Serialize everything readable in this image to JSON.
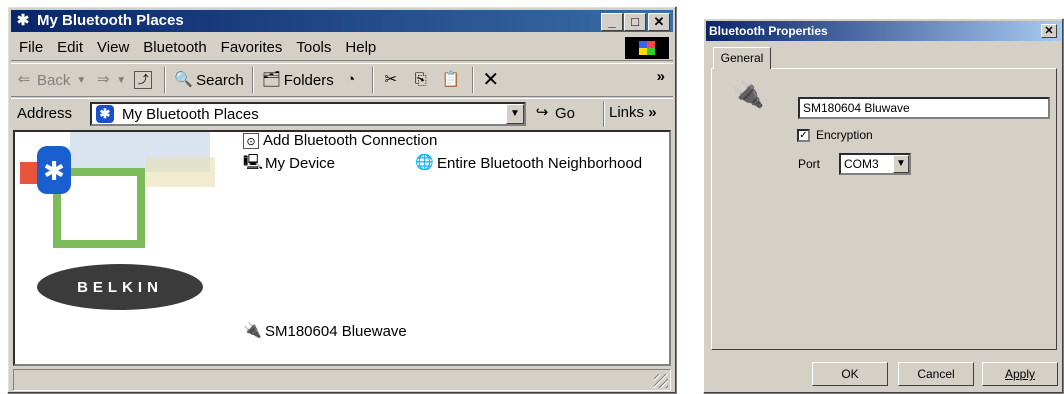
{
  "explorer": {
    "title": "My Bluetooth Places",
    "menu": [
      "File",
      "Edit",
      "View",
      "Bluetooth",
      "Favorites",
      "Tools",
      "Help"
    ],
    "toolbar": {
      "back": "Back",
      "search": "Search",
      "folders": "Folders"
    },
    "address": {
      "label": "Address",
      "value": "My Bluetooth Places",
      "go": "Go",
      "links": "Links"
    },
    "items": {
      "add_connection": "Add Bluetooth Connection",
      "my_device": "My Device",
      "neighborhood": "Entire Bluetooth Neighborhood",
      "device": "SM180604 Bluewave"
    },
    "brand": "BELKIN"
  },
  "dialog": {
    "title": "Bluetooth Properties",
    "tab": "General",
    "name_value": "SM180604 Bluwave",
    "encryption_label": "Encryption",
    "encryption_checked": true,
    "port_label": "Port",
    "port_value": "COM3",
    "buttons": {
      "ok": "OK",
      "cancel": "Cancel",
      "apply": "Apply"
    }
  }
}
